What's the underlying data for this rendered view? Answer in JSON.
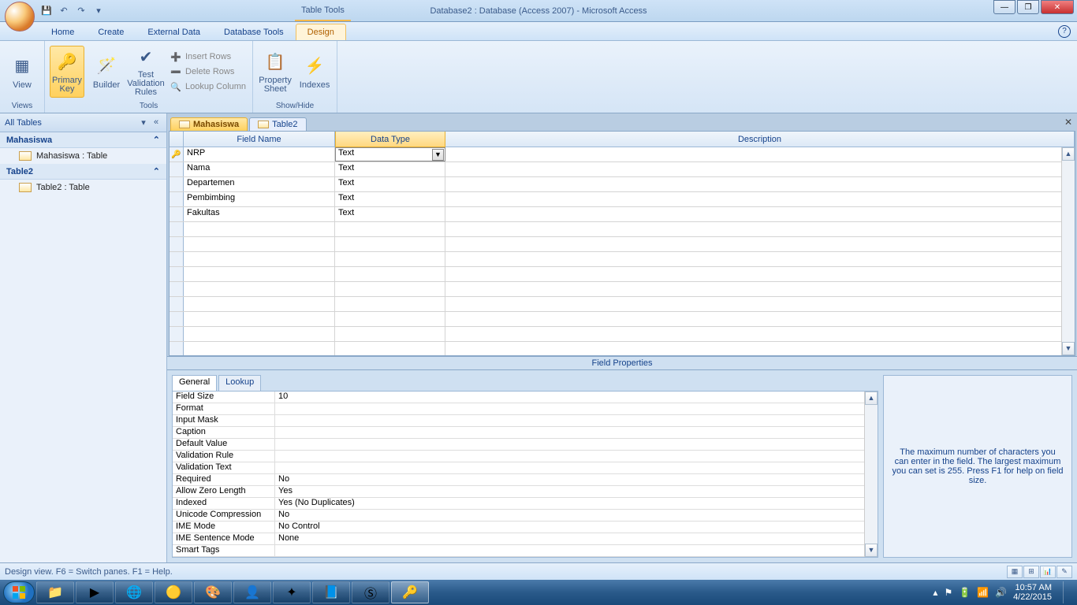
{
  "title": {
    "tools_label": "Table Tools",
    "main": "Database2 : Database (Access 2007)  -  Microsoft Access"
  },
  "tabs": {
    "home": "Home",
    "create": "Create",
    "external": "External Data",
    "dbtools": "Database Tools",
    "design": "Design"
  },
  "ribbon": {
    "view": "View",
    "views_grp": "Views",
    "primary_key": "Primary Key",
    "builder": "Builder",
    "test_validation": "Test Validation Rules",
    "insert_rows": "Insert Rows",
    "delete_rows": "Delete Rows",
    "lookup_column": "Lookup Column",
    "tools_grp": "Tools",
    "property_sheet": "Property Sheet",
    "indexes": "Indexes",
    "showhide_grp": "Show/Hide"
  },
  "nav": {
    "header": "All Tables",
    "group1": "Mahasiswa",
    "item1": "Mahasiswa : Table",
    "group2": "Table2",
    "item2": "Table2 : Table"
  },
  "doc_tabs": {
    "t1": "Mahasiswa",
    "t2": "Table2"
  },
  "grid": {
    "h_field": "Field Name",
    "h_type": "Data Type",
    "h_desc": "Description",
    "rows": [
      {
        "pk": true,
        "name": "NRP",
        "type": "Text"
      },
      {
        "pk": false,
        "name": "Nama",
        "type": "Text"
      },
      {
        "pk": false,
        "name": "Departemen",
        "type": "Text"
      },
      {
        "pk": false,
        "name": "Pembimbing",
        "type": "Text"
      },
      {
        "pk": false,
        "name": "Fakultas",
        "type": "Text"
      }
    ]
  },
  "fp": {
    "title": "Field Properties",
    "tab_general": "General",
    "tab_lookup": "Lookup",
    "rows": [
      {
        "k": "Field Size",
        "v": "10"
      },
      {
        "k": "Format",
        "v": ""
      },
      {
        "k": "Input Mask",
        "v": ""
      },
      {
        "k": "Caption",
        "v": ""
      },
      {
        "k": "Default Value",
        "v": ""
      },
      {
        "k": "Validation Rule",
        "v": ""
      },
      {
        "k": "Validation Text",
        "v": ""
      },
      {
        "k": "Required",
        "v": "No"
      },
      {
        "k": "Allow Zero Length",
        "v": "Yes"
      },
      {
        "k": "Indexed",
        "v": "Yes (No Duplicates)"
      },
      {
        "k": "Unicode Compression",
        "v": "No"
      },
      {
        "k": "IME Mode",
        "v": "No Control"
      },
      {
        "k": "IME Sentence Mode",
        "v": "None"
      },
      {
        "k": "Smart Tags",
        "v": ""
      }
    ],
    "help": "The maximum number of characters you can enter in the field.  The largest maximum you can set is 255.  Press F1 for help on field size."
  },
  "status": "Design view.   F6 = Switch panes.   F1 = Help.",
  "tray": {
    "time": "10:57 AM",
    "date": "4/22/2015"
  }
}
